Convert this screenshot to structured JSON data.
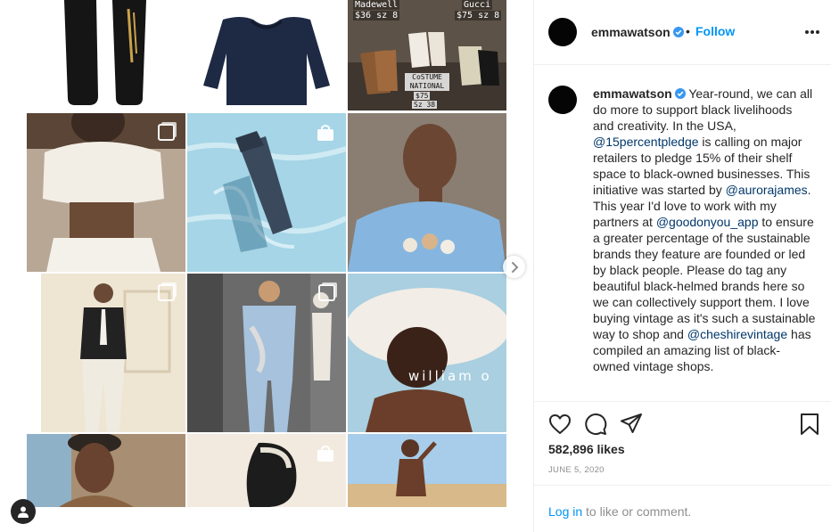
{
  "post": {
    "author": "emmawatson",
    "verified": true,
    "separator": "•",
    "follow_label": "Follow",
    "caption": {
      "segments": [
        {
          "type": "text",
          "text": " Year-round, we can all do more to support black livelihoods and creativity. In the USA, "
        },
        {
          "type": "mention",
          "text": "@15percentpledge"
        },
        {
          "type": "text",
          "text": " is calling on major retailers to pledge 15% of their shelf space to black-owned businesses. This initiative was started by "
        },
        {
          "type": "mention",
          "text": "@aurorajames"
        },
        {
          "type": "text",
          "text": ". This year I'd love to work with my partners at "
        },
        {
          "type": "mention",
          "text": "@goodonyou_app"
        },
        {
          "type": "text",
          "text": " to ensure a greater percentage of the sustainable brands they feature are founded or led by black people. Please do tag any beautiful black-helmed brands here so we can collectively support them. I love buying vintage as it's such a sustainable way to shop and "
        },
        {
          "type": "mention",
          "text": "@cheshirevintage"
        },
        {
          "type": "text",
          "text": " has compiled an amazing list of black-owned vintage shops."
        }
      ]
    },
    "likes": "582,896 likes",
    "date": "JUNE 5, 2020",
    "comment_prompt": {
      "login_label": "Log in",
      "rest": " to like or comment."
    }
  },
  "grid": {
    "overlay_text": {
      "madewell_label": "Madewell",
      "madewell_price": "$36 sz 8",
      "gucci_label": "Gucci",
      "gucci_price": "$75 sz 8",
      "costume_label": "CoSTUME NATIONAL",
      "costume_price": "$75",
      "costume_size": "Sz 38",
      "brand_watermark": "william o"
    }
  },
  "colors": {
    "accent": "#0095f6",
    "mention": "#00376b",
    "text": "#262626",
    "muted": "#8e8e8e",
    "divider": "#efefef",
    "verified": "#3897f0"
  },
  "icons": {
    "header_more": "more-options-icon",
    "verified": "verified-badge-icon",
    "like": "heart-icon",
    "comment": "comment-icon",
    "share": "paper-plane-icon",
    "save": "bookmark-icon",
    "carousel_next": "chevron-right-icon",
    "multi_photo": "multiple-photos-icon",
    "shopping": "shopping-bag-icon",
    "user": "user-icon"
  }
}
